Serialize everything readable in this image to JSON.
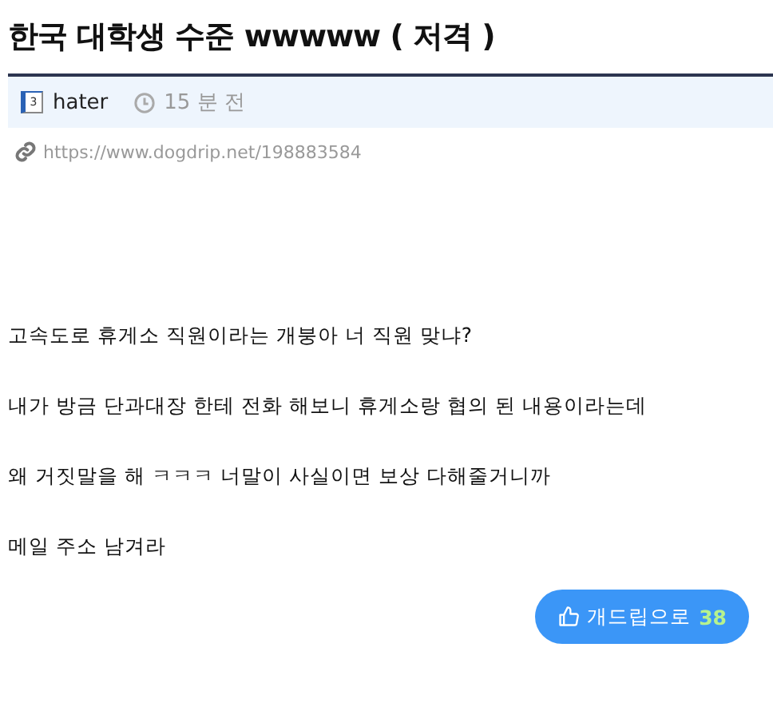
{
  "post": {
    "title": "한국 대학생 수준 wwwww ( 저격 )",
    "author": {
      "level": "3",
      "name": "hater"
    },
    "time": "15 분 전",
    "link": "https://www.dogdrip.net/198883584"
  },
  "body": [
    "고속도로 휴게소 직원이라는 개붕아 너 직원 맞냐?",
    "내가 방금 단과대장 한테 전화 해보니 휴게소랑 협의 된 내용이라는데",
    "왜 거짓말을 해 ㅋㅋㅋ 너말이 사실이면 보상 다해줄거니까",
    "메일 주소 남겨라"
  ],
  "vote": {
    "label": "개드립으로",
    "count": "38"
  }
}
